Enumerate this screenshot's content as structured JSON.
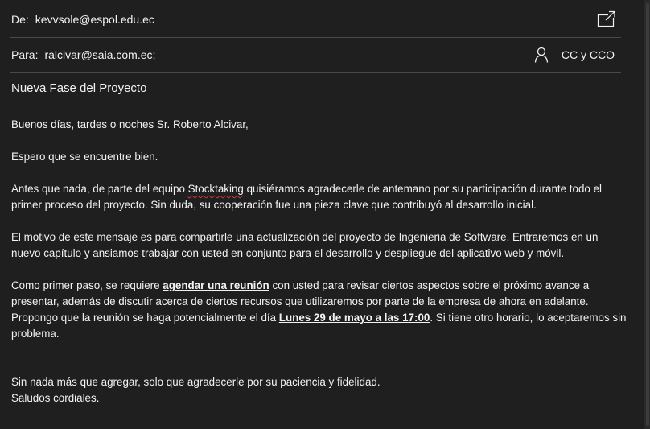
{
  "header": {
    "from_label": "De:",
    "from_value": "kevvsole@espol.edu.ec",
    "to_label": "Para:",
    "to_value": "ralcivar@saia.com.ec;",
    "cc_label": "CC y CCO",
    "subject": "Nueva Fase del Proyecto",
    "icons": {
      "popout": "popout-window-icon",
      "person": "person-icon"
    }
  },
  "body": {
    "greeting": "Buenos días, tardes o noches Sr. Roberto Alcivar,",
    "line2": "Espero que se encuentre bien.",
    "p3_a": "Antes que nada, de parte del equipo ",
    "p3_misspelled": "Stocktaking",
    "p3_b": " quisiéramos agradecerle de antemano por su participación durante todo el primer proceso del proyecto. Sin duda, su cooperación fue una pieza clave que contribuyó al desarrollo inicial.",
    "p4": "El motivo de este mensaje es para compartirle una actualización del proyecto de Ingenieria de Software. Entraremos en un nuevo capítulo y ansiamos trabajar con usted en conjunto para el desarrollo y despliegue del aplicativo web y móvil.",
    "p5_a": "Como primer paso, se requiere ",
    "p5_b1": "agendar una reunión",
    "p5_c": " con usted para revisar ciertos aspectos sobre el próximo avance a presentar, además de discutir acerca de ciertos recursos que utilizaremos por parte de la empresa de ahora en adelante. Propongo que la reunión se haga potencialmente el día ",
    "p5_b2": "Lunes 29 de mayo a las 17:00",
    "p5_d": ". Si tiene otro horario, lo aceptaremos sin problema.",
    "closing1": "Sin nada más que agregar, solo que agradecerle por su paciencia y fidelidad.",
    "closing2": "Saludos cordiales."
  },
  "colors": {
    "background": "#1f1f1f",
    "text": "#f2f2f2",
    "divider": "#4a4a4a",
    "spellcheck": "#d23c3c"
  }
}
